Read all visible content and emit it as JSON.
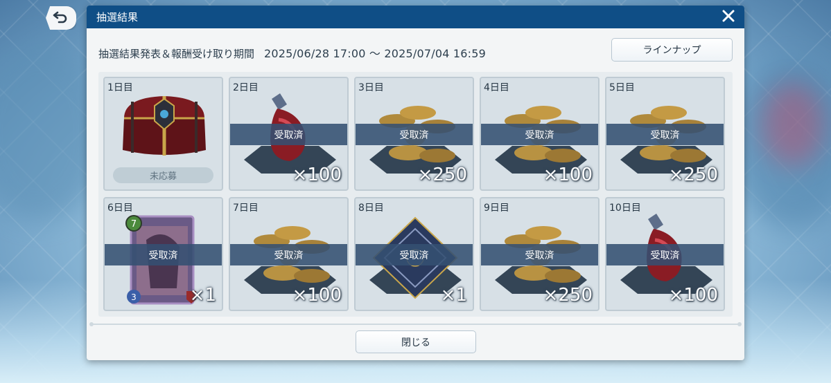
{
  "dialog": {
    "title": "抽選結果",
    "period_label": "抽選結果発表＆報酬受け取り期間",
    "period_value": "2025/06/28 17:00 ～ 2025/07/04 16:59",
    "lineup_button": "ラインナップ",
    "close_button": "閉じる"
  },
  "days": [
    {
      "day": "1日目",
      "item": "treasure-chest",
      "status": "未応募",
      "qty": ""
    },
    {
      "day": "2日目",
      "item": "potion",
      "status": "受取済",
      "qty": "×100"
    },
    {
      "day": "3日目",
      "item": "coins",
      "status": "受取済",
      "qty": "×250"
    },
    {
      "day": "4日目",
      "item": "coins",
      "status": "受取済",
      "qty": "×100"
    },
    {
      "day": "5日目",
      "item": "coins",
      "status": "受取済",
      "qty": "×250"
    },
    {
      "day": "6日目",
      "item": "card",
      "status": "受取済",
      "qty": "×1"
    },
    {
      "day": "7日目",
      "item": "coins",
      "status": "受取済",
      "qty": "×100"
    },
    {
      "day": "8日目",
      "item": "card-sleeve",
      "status": "受取済",
      "qty": "×1"
    },
    {
      "day": "9日目",
      "item": "coins",
      "status": "受取済",
      "qty": "×250"
    },
    {
      "day": "10日目",
      "item": "potion",
      "status": "受取済",
      "qty": "×100"
    }
  ],
  "colors": {
    "title_bar": "#0f4e86",
    "banner": "#345072",
    "panel": "#f3f5f6"
  }
}
